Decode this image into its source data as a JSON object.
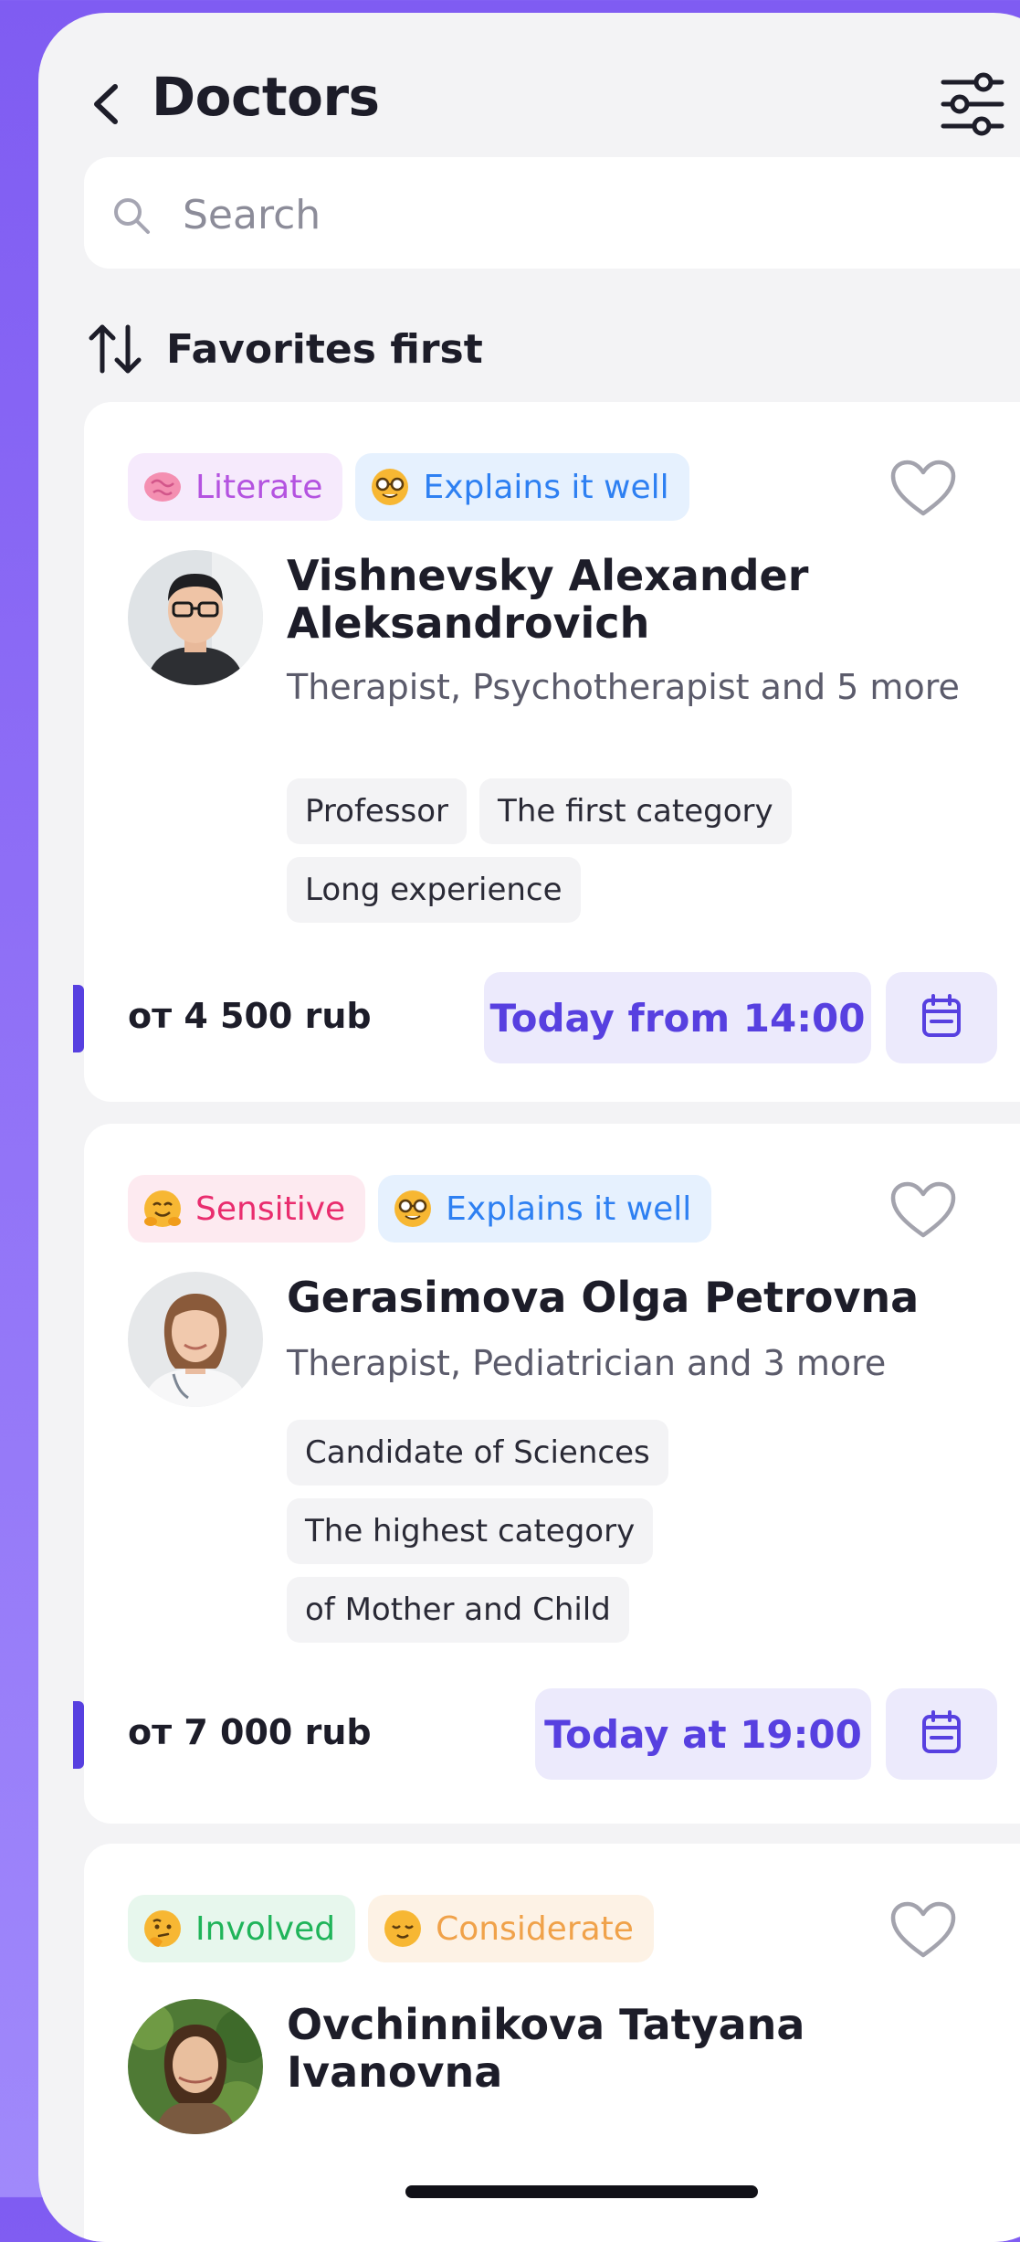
{
  "header": {
    "title": "Doctors"
  },
  "search": {
    "placeholder": "Search"
  },
  "sort": {
    "label": "Favorites first"
  },
  "colors": {
    "accent": "#5740e0",
    "accent_bg": "#eceafc",
    "screen_bg": "#f3f3f5"
  },
  "doctors": [
    {
      "badges": [
        {
          "emoji_icon": "brain-icon",
          "label": "Literate",
          "color": "#b453e0",
          "bg": "#f6eafc"
        },
        {
          "emoji_icon": "nerd-face-icon",
          "label": "Explains it well",
          "color": "#2e80f2",
          "bg": "#e6f1fe"
        }
      ],
      "name": "Vishnevsky Alexander Aleksandrovich",
      "specialties": "Therapist, Psychotherapist and 5 more",
      "tags": [
        "Professor",
        "The first category",
        "Long experience"
      ],
      "price": "от 4 500 rub",
      "slot": "Today from 14:00",
      "favorite": false
    },
    {
      "badges": [
        {
          "emoji_icon": "smiling-hug-icon",
          "label": "Sensitive",
          "color": "#e92d6e",
          "bg": "#fdeaf0"
        },
        {
          "emoji_icon": "nerd-face-icon",
          "label": "Explains it well",
          "color": "#2e80f2",
          "bg": "#e6f1fe"
        }
      ],
      "name": "Gerasimova Olga Petrovna",
      "specialties": "Therapist, Pediatrician and 3 more",
      "tags": [
        "Candidate of Sciences",
        "The highest category",
        "of Mother and Child"
      ],
      "price": "от 7 000 rub",
      "slot": "Today at 19:00",
      "favorite": false
    },
    {
      "badges": [
        {
          "emoji_icon": "thinking-face-icon",
          "label": "Involved",
          "color": "#20b45a",
          "bg": "#e7f7ed"
        },
        {
          "emoji_icon": "relieved-face-icon",
          "label": "Considerate",
          "color": "#f0a24a",
          "bg": "#fdf2e5"
        }
      ],
      "name": "Ovchinnikova Tatyana Ivanovna",
      "favorite": false
    }
  ]
}
